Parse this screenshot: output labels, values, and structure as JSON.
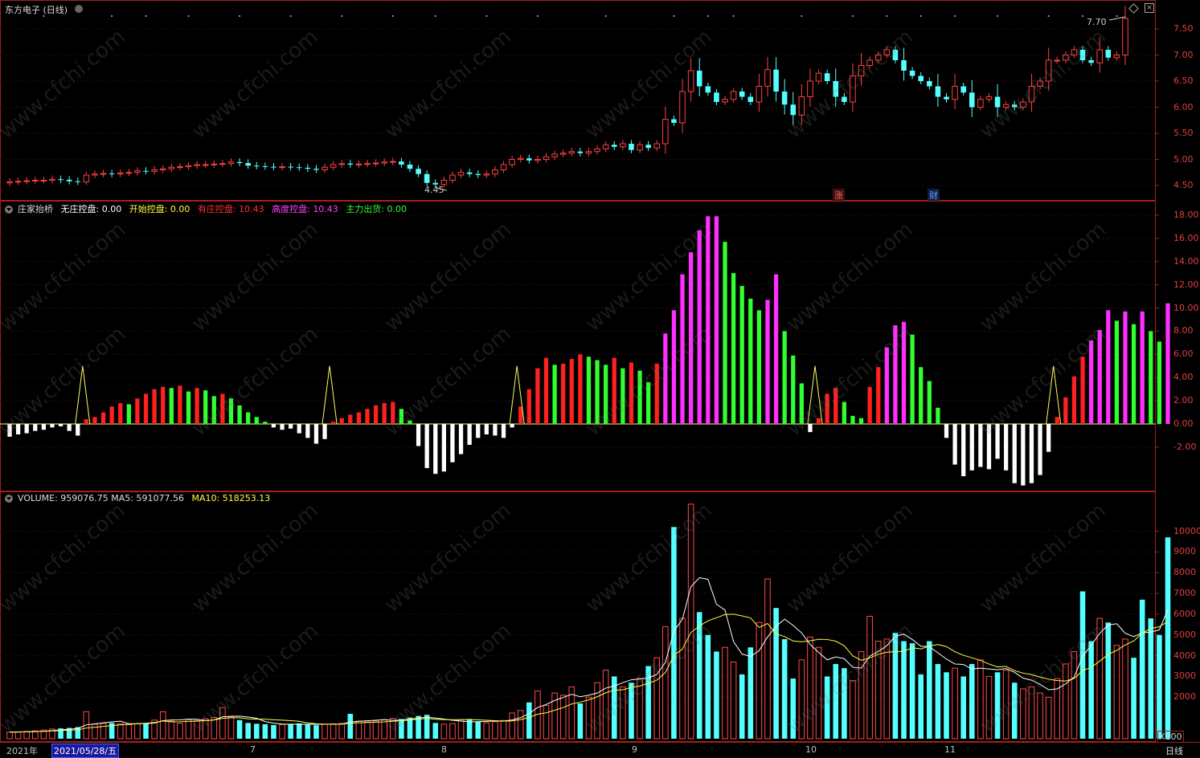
{
  "chart_title": "东方电子 (日线)",
  "price_pane": {
    "high_label": "7.70",
    "low_label": "4.45",
    "y_ticks": [
      "7.50",
      "7.00",
      "6.50",
      "6.00",
      "5.50",
      "5.00",
      "4.50"
    ],
    "event_badges": [
      "涨",
      "财"
    ]
  },
  "indicator_pane": {
    "name": "庄家抬桥",
    "legend": [
      {
        "label": "无庄控盘",
        "value": "0.00",
        "color": "#ffffff"
      },
      {
        "label": "开始控盘",
        "value": "0.00",
        "color": "#ffff40"
      },
      {
        "label": "有庄控盘",
        "value": "10.43",
        "color": "#ff3030"
      },
      {
        "label": "高度控盘",
        "value": "10.43",
        "color": "#ff40ff"
      },
      {
        "label": "主力出货",
        "value": "0.00",
        "color": "#30ff30"
      }
    ],
    "y_ticks": [
      "18.00",
      "16.00",
      "14.00",
      "12.00",
      "10.00",
      "8.00",
      "6.00",
      "4.00",
      "2.00",
      "0.00",
      "-2.00"
    ]
  },
  "volume_pane": {
    "name": "VOLUME",
    "value": "959076.75",
    "ma5_label": "MA5",
    "ma5": "591077.56",
    "ma10_label": "MA10",
    "ma10": "518253.13",
    "y_ticks": [
      "10000",
      "9000",
      "8000",
      "7000",
      "6000",
      "5000",
      "4000",
      "3000",
      "2000"
    ],
    "unit": "X100"
  },
  "x_axis": {
    "labels": [
      "2021年",
      "7",
      "8",
      "9",
      "10",
      "11"
    ],
    "selected": "2021/05/28/五",
    "period": "日线"
  },
  "watermark": "www.cfchi.com",
  "chart_data": {
    "type": "candlestick",
    "close": [
      4.57,
      4.58,
      4.59,
      4.6,
      4.6,
      4.62,
      4.61,
      4.58,
      4.57,
      4.7,
      4.72,
      4.73,
      4.72,
      4.74,
      4.75,
      4.78,
      4.77,
      4.8,
      4.82,
      4.85,
      4.86,
      4.88,
      4.9,
      4.9,
      4.91,
      4.92,
      4.95,
      4.93,
      4.88,
      4.87,
      4.86,
      4.85,
      4.86,
      4.85,
      4.84,
      4.82,
      4.8,
      4.85,
      4.9,
      4.92,
      4.9,
      4.91,
      4.92,
      4.93,
      4.95,
      4.96,
      4.9,
      4.82,
      4.72,
      4.55,
      4.52,
      4.6,
      4.7,
      4.75,
      4.72,
      4.7,
      4.72,
      4.8,
      4.9,
      5.0,
      5.02,
      4.98,
      5.0,
      5.05,
      5.1,
      5.12,
      5.15,
      5.12,
      5.15,
      5.2,
      5.28,
      5.24,
      5.3,
      5.18,
      5.28,
      5.22,
      5.3,
      5.77,
      5.7,
      6.3,
      6.7,
      6.4,
      6.28,
      6.1,
      6.15,
      6.3,
      6.2,
      6.1,
      6.4,
      6.72,
      6.3,
      6.05,
      5.85,
      6.2,
      6.5,
      6.65,
      6.5,
      6.2,
      6.1,
      6.6,
      6.8,
      6.9,
      7.0,
      7.1,
      6.9,
      6.7,
      6.6,
      6.5,
      6.4,
      6.2,
      6.15,
      6.4,
      6.28,
      6.0,
      6.15,
      6.2,
      6.0,
      6.05,
      6.0,
      6.1,
      6.4,
      6.5,
      6.9,
      6.9,
      7.0,
      7.1,
      6.9,
      6.85,
      7.1,
      6.95,
      7.0,
      7.7
    ],
    "volume_x100": [
      320,
      330,
      350,
      380,
      420,
      470,
      500,
      520,
      560,
      1300,
      700,
      740,
      760,
      720,
      680,
      720,
      760,
      900,
      1300,
      850,
      740,
      920,
      880,
      960,
      1020,
      1500,
      1050,
      900,
      760,
      720,
      700,
      660,
      680,
      720,
      740,
      690,
      650,
      700,
      720,
      740,
      1200,
      850,
      810,
      860,
      900,
      980,
      950,
      1020,
      1100,
      1150,
      760,
      700,
      730,
      920,
      950,
      820,
      770,
      820,
      880,
      1240,
      1360,
      1750,
      2300,
      1600,
      2200,
      2100,
      2500,
      1700,
      2000,
      2700,
      3300,
      3000,
      2500,
      2700,
      2900,
      3500,
      3900,
      5400,
      10200,
      5800,
      11300,
      6100,
      5000,
      4200,
      4400,
      3700,
      3100,
      4400,
      5600,
      7700,
      6300,
      4800,
      2900,
      3800,
      4900,
      4400,
      3000,
      3600,
      3400,
      2800,
      4200,
      5900,
      4700,
      4800,
      5100,
      4700,
      4600,
      3100,
      4700,
      3600,
      3200,
      3400,
      3000,
      3600,
      3800,
      3000,
      3200,
      3300,
      2700,
      2400,
      2500,
      2200,
      2000,
      2900,
      3600,
      4200,
      7100,
      4700,
      5800,
      5600,
      4500,
      4800,
      3900,
      6700,
      5800,
      5000,
      9700
    ],
    "indicator": [
      -1.1,
      -0.9,
      -0.8,
      -0.6,
      -0.5,
      -0.3,
      -0.2,
      -0.6,
      -1.0,
      0.4,
      0.6,
      1.0,
      1.5,
      1.8,
      1.7,
      2.2,
      2.6,
      3.0,
      3.2,
      3.1,
      3.3,
      2.8,
      3.1,
      2.9,
      2.4,
      2.6,
      2.2,
      1.6,
      1.0,
      0.6,
      0.2,
      -0.3,
      -0.5,
      -0.4,
      -0.8,
      -1.2,
      -1.7,
      -1.3,
      0.2,
      0.5,
      0.8,
      1.0,
      1.3,
      1.6,
      1.8,
      1.9,
      1.3,
      0.3,
      -1.9,
      -3.8,
      -4.3,
      -4.1,
      -3.3,
      -2.6,
      -1.8,
      -1.2,
      -0.9,
      -1.0,
      -1.2,
      -0.3,
      1.5,
      3.0,
      4.8,
      5.7,
      5.1,
      5.2,
      5.6,
      6.0,
      5.8,
      5.5,
      5.1,
      5.7,
      4.8,
      5.3,
      4.6,
      3.6,
      5.2,
      7.8,
      9.8,
      12.9,
      14.8,
      16.7,
      17.9,
      17.9,
      15.7,
      13.0,
      11.9,
      10.8,
      9.8,
      10.7,
      12.9,
      8.0,
      5.9,
      3.5,
      -0.7,
      0.5,
      2.6,
      3.1,
      1.9,
      0.7,
      0.5,
      3.2,
      4.9,
      6.6,
      8.5,
      8.8,
      7.7,
      4.9,
      3.7,
      1.4,
      -1.2,
      -3.5,
      -4.5,
      -4.0,
      -3.7,
      -3.9,
      -3.0,
      -4.0,
      -5.1,
      -5.3,
      -5.1,
      -4.4,
      -2.4,
      0.6,
      2.3,
      4.1,
      5.8,
      7.2,
      8.1,
      9.8,
      8.9,
      9.7,
      8.6,
      9.7,
      8.0,
      7.1,
      10.4
    ]
  }
}
